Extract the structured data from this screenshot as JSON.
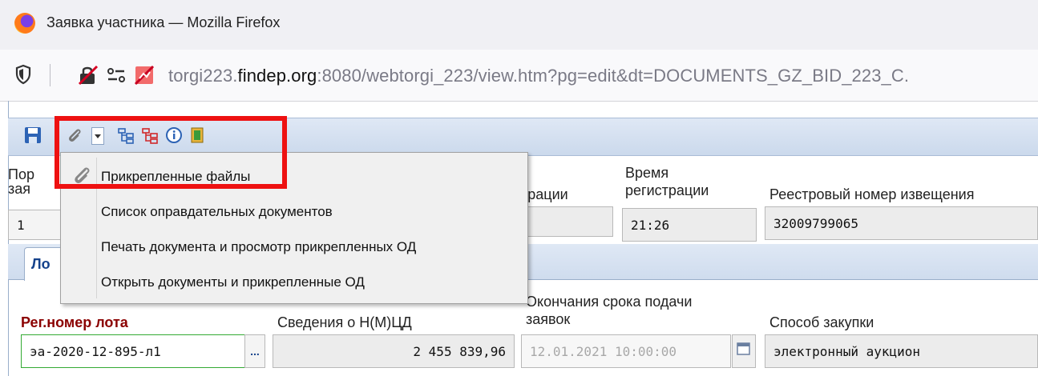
{
  "window": {
    "title": "Заявка участника — Mozilla Firefox"
  },
  "address_bar": {
    "url_prefix": "torgi223.",
    "url_host": "findep.org",
    "url_rest": ":8080/webtorgi_223/view.htm?pg=edit&dt=DOCUMENTS_GZ_BID_223_C."
  },
  "header_fields": {
    "order_label_line1": "Пор",
    "order_label_line2": "зая",
    "order_value": "1",
    "reg_date_label_fragment": "трации",
    "reg_time_label_line1": "Время",
    "reg_time_label_line2": "регистрации",
    "reg_time_value": "21:26",
    "registry_label": "Реестровый номер извещения",
    "registry_value": "32009799065"
  },
  "tabs": {
    "lot_tab_fragment": "Ло"
  },
  "dropdown_menu": {
    "items": [
      "Прикрепленные файлы",
      "Список оправдательных документов",
      "Печать документа и просмотр прикрепленных ОД",
      "Открыть документы и прикрепленные ОД"
    ]
  },
  "lot_fields": {
    "reg_lot_label": "Рег.номер лота",
    "reg_lot_value": "эа-2020-12-895-л1",
    "lookup_label": "...",
    "nmcd_label": "Сведения о Н(М)ЦД",
    "nmcd_value": "2 455 839,96",
    "deadline_label_line1": "Окончания срока подачи",
    "deadline_label_line2": "заявок",
    "deadline_value": "12.01.2021 10:00:00",
    "method_label": "Способ закупки",
    "method_value": "электронный аукцион"
  },
  "colors": {
    "highlight_box": "#ee1111",
    "required_label": "#8b0000",
    "active_field_border": "#33aa33"
  }
}
